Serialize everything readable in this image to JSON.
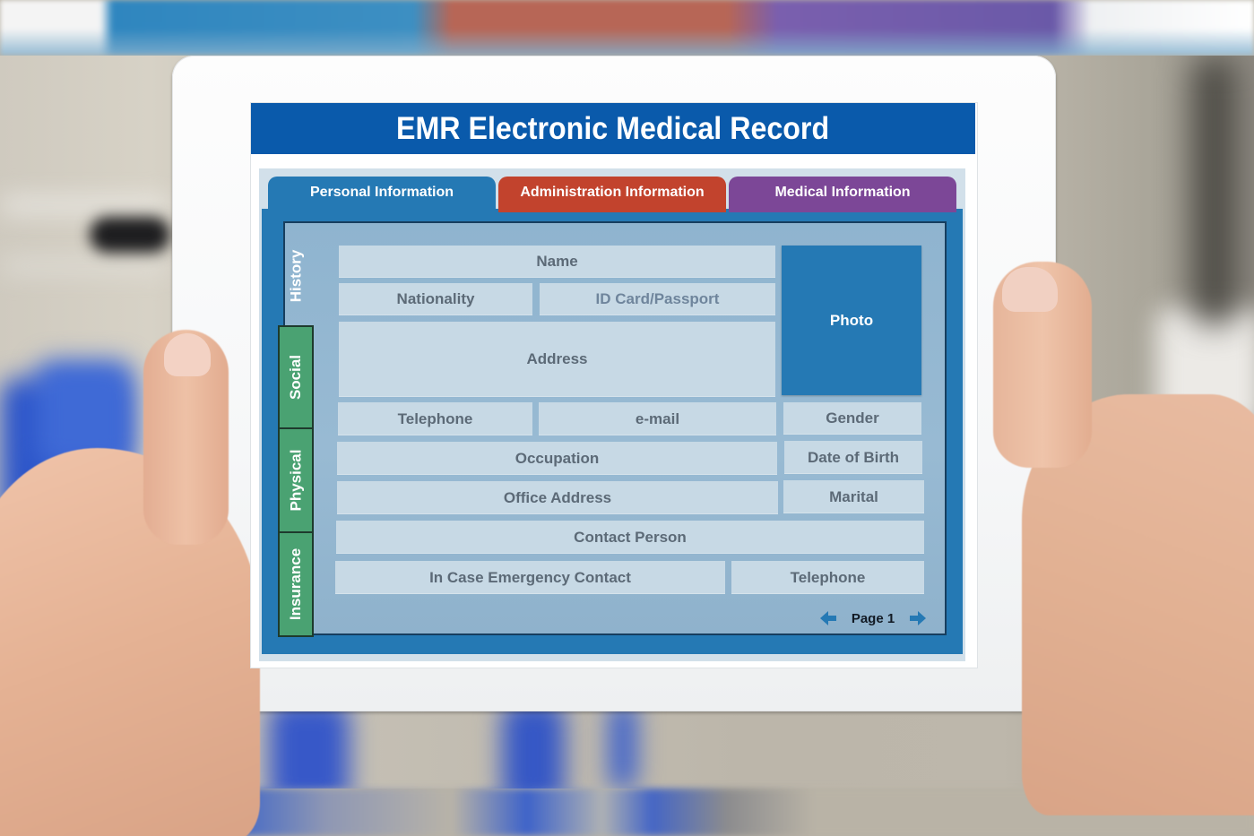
{
  "app": {
    "title": "EMR Electronic Medical Record"
  },
  "tabs": [
    {
      "label": "Personal Information",
      "color": "#2579b4",
      "active": true
    },
    {
      "label": "Administration Information",
      "color": "#c2432d",
      "active": false
    },
    {
      "label": "Medical  Information",
      "color": "#7c4797",
      "active": false
    }
  ],
  "side_tabs": [
    {
      "label": "History",
      "active": true
    },
    {
      "label": "Social",
      "active": false
    },
    {
      "label": "Physical",
      "active": false
    },
    {
      "label": "Insurance",
      "active": false
    }
  ],
  "fields": {
    "name": "Name",
    "nationality": "Nationality",
    "id_card": "ID Card/Passport",
    "address": "Address",
    "photo": "Photo",
    "telephone": "Telephone",
    "email": "e-mail",
    "gender": "Gender",
    "occupation": "Occupation",
    "date_of_birth": "Date of Birth",
    "office_address": "Office Address",
    "marital": "Marital",
    "contact_person": "Contact Person",
    "emergency_contact": "In Case Emergency Contact",
    "emergency_telephone": "Telephone"
  },
  "pager": {
    "label": "Page 1",
    "prev_icon": "arrow-left-icon",
    "next_icon": "arrow-right-icon"
  },
  "colors": {
    "title_bar": "#0a5aab",
    "frame": "#2579b4",
    "field_bg": "#c7d9e5",
    "side_tab_green": "#4aa272"
  }
}
